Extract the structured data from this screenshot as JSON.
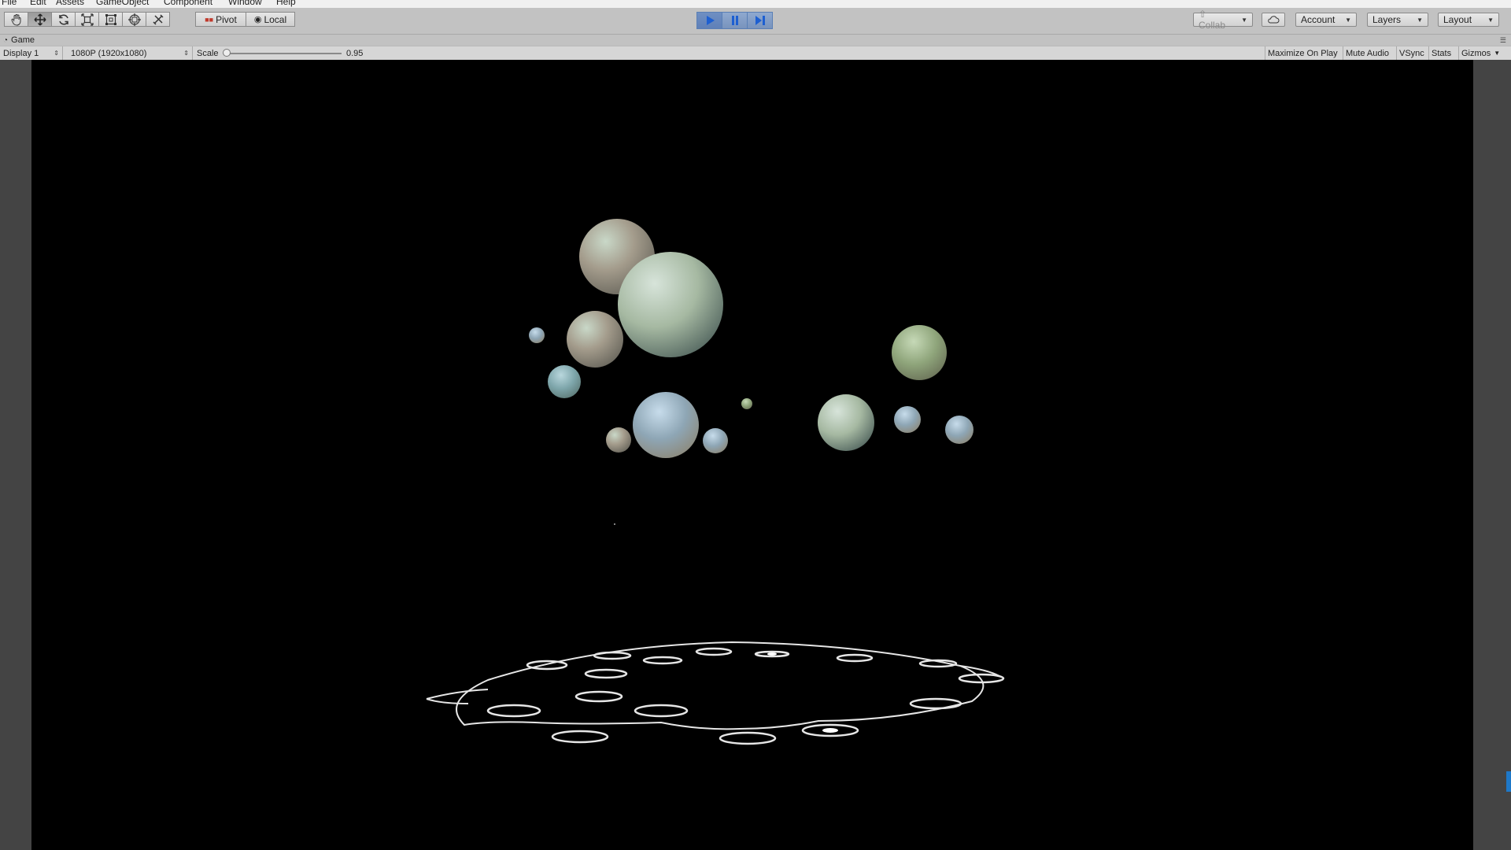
{
  "menu": {
    "items": [
      "File",
      "Edit",
      "Assets",
      "GameObject",
      "Component",
      "Window",
      "Help"
    ]
  },
  "toolbar": {
    "transform_tools": [
      {
        "name": "hand-tool",
        "icon": "hand-icon",
        "active": false
      },
      {
        "name": "move-tool",
        "icon": "move-arrows-icon",
        "active": true
      },
      {
        "name": "rotate-tool",
        "icon": "rotate-icon",
        "active": false
      },
      {
        "name": "scale-tool",
        "icon": "scale-icon",
        "active": false
      },
      {
        "name": "rect-tool",
        "icon": "rect-icon",
        "active": false
      },
      {
        "name": "transform-tool",
        "icon": "transform-icon",
        "active": false
      },
      {
        "name": "custom-tool",
        "icon": "tools-icon",
        "active": false
      }
    ],
    "pivot_label": "Pivot",
    "local_label": "Local",
    "collab_label": "Collab",
    "account_label": "Account",
    "layers_label": "Layers",
    "layout_label": "Layout"
  },
  "game_tab": {
    "title": "Game"
  },
  "game_bar": {
    "display": "Display 1",
    "resolution": "1080P (1920x1080)",
    "scale_label": "Scale",
    "scale_value": "0.95",
    "scale_fraction": 0.0,
    "maximize_on_play": "Maximize On Play",
    "mute_audio": "Mute Audio",
    "vsync": "VSync",
    "stats": "Stats",
    "gizmos": "Gizmos"
  },
  "colors": {
    "toolbar_bg": "#c2c2c2",
    "play_active": "#5f80b8",
    "viewport_bg": "#000000",
    "side_frame": "#444444"
  }
}
